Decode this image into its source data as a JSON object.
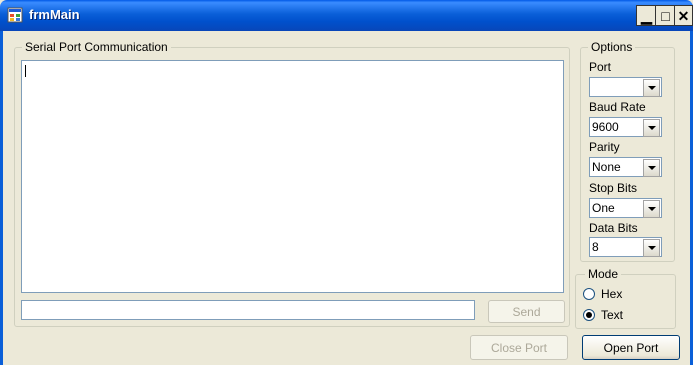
{
  "window": {
    "title": "frmMain"
  },
  "serial_group": {
    "title": "Serial Port Communication",
    "output_text": "",
    "input_value": "",
    "send_label": "Send"
  },
  "options": {
    "title": "Options",
    "port": {
      "label": "Port",
      "value": ""
    },
    "baud": {
      "label": "Baud Rate",
      "value": "9600"
    },
    "parity": {
      "label": "Parity",
      "value": "None"
    },
    "stopbits": {
      "label": "Stop Bits",
      "value": "One"
    },
    "databits": {
      "label": "Data Bits",
      "value": "8"
    }
  },
  "mode": {
    "title": "Mode",
    "hex": {
      "label": "Hex",
      "checked": false
    },
    "text": {
      "label": "Text",
      "checked": true
    }
  },
  "buttons": {
    "close_port": "Close Port",
    "open_port": "Open Port"
  }
}
